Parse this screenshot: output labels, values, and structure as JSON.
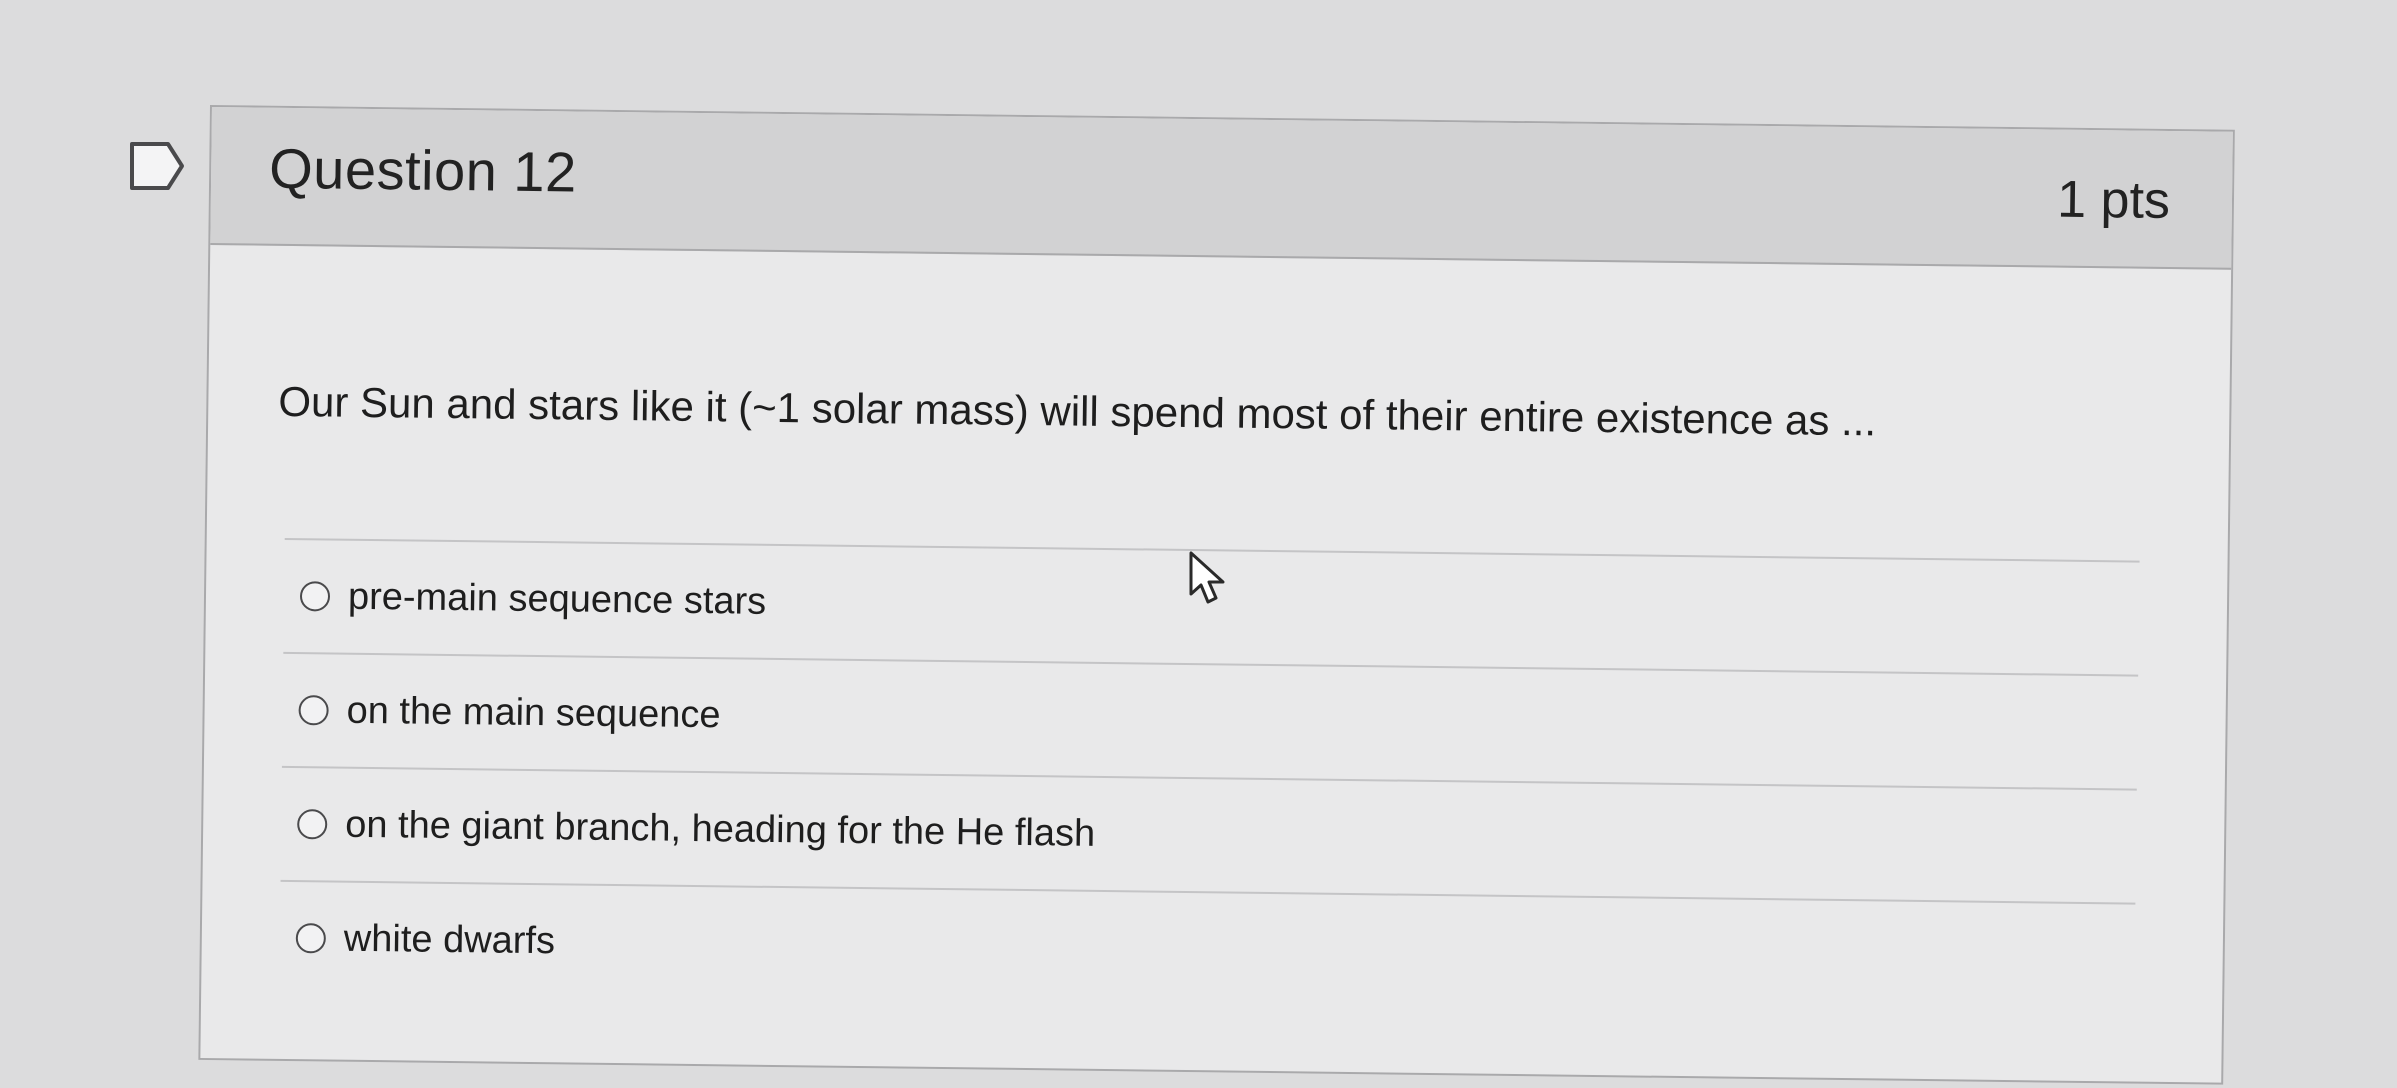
{
  "question": {
    "title": "Question 12",
    "points": "1 pts",
    "text": "Our Sun and stars like it (~1 solar mass) will spend most of their entire existence as ...",
    "answers": [
      {
        "label": "pre-main sequence stars",
        "selected": false
      },
      {
        "label": "on the main sequence",
        "selected": false
      },
      {
        "label": "on the giant branch, heading for the He flash",
        "selected": false
      },
      {
        "label": "white dwarfs",
        "selected": false
      }
    ]
  },
  "icons": {
    "flag": "flag-question-icon",
    "cursor": "mouse-pointer-icon"
  },
  "colors": {
    "header_bg": "#d2d2d3",
    "card_bg": "#e9e9ea",
    "border": "#a9a9ab",
    "text": "#1e1e1e"
  }
}
